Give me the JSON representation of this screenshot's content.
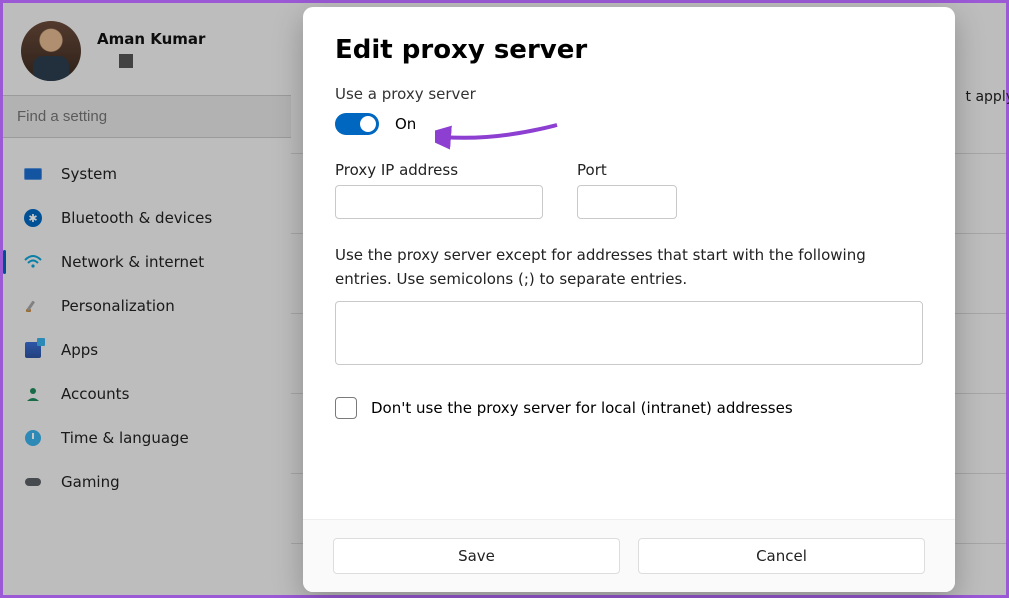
{
  "profile": {
    "name": "Aman Kumar"
  },
  "search": {
    "placeholder": "Find a setting"
  },
  "sidebar": {
    "items": [
      {
        "label": "System"
      },
      {
        "label": "Bluetooth & devices"
      },
      {
        "label": "Network & internet"
      },
      {
        "label": "Personalization"
      },
      {
        "label": "Apps"
      },
      {
        "label": "Accounts"
      },
      {
        "label": "Time & language"
      },
      {
        "label": "Gaming"
      }
    ]
  },
  "background": {
    "apply_fragment": "t apply"
  },
  "modal": {
    "title": "Edit proxy server",
    "use_proxy_label": "Use a proxy server",
    "toggle_state": "On",
    "ip_label": "Proxy IP address",
    "port_label": "Port",
    "ip_value": "",
    "port_value": "",
    "exceptions_label": "Use the proxy server except for addresses that start with the following entries. Use semicolons (;) to separate entries.",
    "exceptions_value": "",
    "local_bypass_label": "Don't use the proxy server for local (intranet) addresses",
    "save_label": "Save",
    "cancel_label": "Cancel"
  }
}
